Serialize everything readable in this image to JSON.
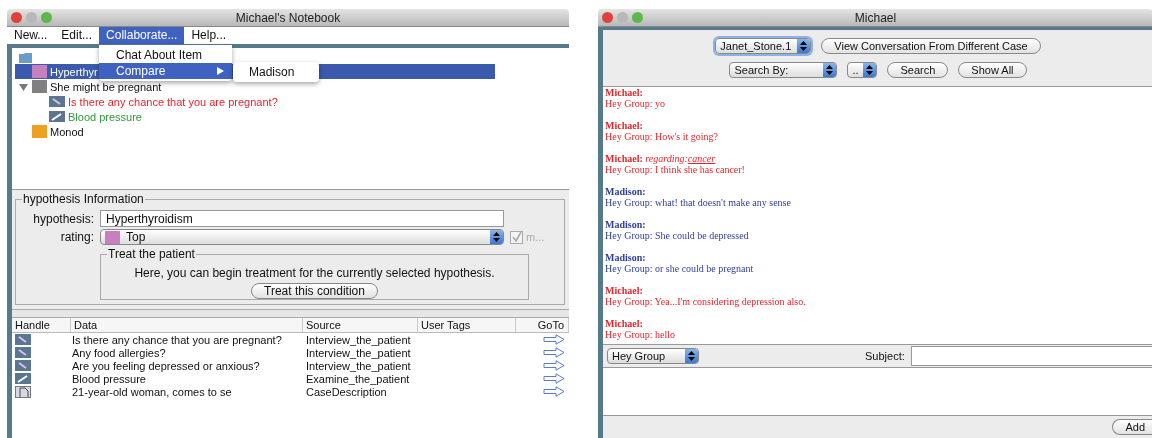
{
  "notebook": {
    "title": "Michael's Notebook",
    "menu": [
      {
        "label": "New...",
        "selected": false
      },
      {
        "label": "Edit...",
        "selected": false
      },
      {
        "label": "Collaborate...",
        "selected": true
      },
      {
        "label": "Help...",
        "selected": false
      }
    ],
    "dropdown": {
      "items": [
        {
          "label": "Chat About Item",
          "selected": false,
          "submenu": false
        },
        {
          "label": "Compare",
          "selected": true,
          "submenu": true
        }
      ],
      "submenu_items": [
        "Madison"
      ]
    },
    "tree": {
      "items": [
        {
          "label": "Hyperthyr",
          "color": "#c67fbf",
          "selected": true
        },
        {
          "label": "She might be pregnant",
          "color": "#808080",
          "selected": false,
          "expanded": true,
          "children": [
            {
              "label": "Is there any chance that you are pregnant?",
              "kind": "interview",
              "color": "#e8242a"
            },
            {
              "label": "Blood pressure",
              "kind": "exam",
              "color": "#2e9a3a"
            }
          ]
        },
        {
          "label": "Monod",
          "color": "#f0a020",
          "selected": false
        }
      ]
    },
    "info": {
      "legend": "hypothesis Information",
      "hypothesis_label": "hypothesis:",
      "hypothesis_value": "Hyperthyroidism",
      "rating_label": "rating:",
      "rating": {
        "value": "Top",
        "color": "#c67fbf"
      },
      "checkbox": {
        "label": "m...",
        "checked": true,
        "disabled": true
      },
      "treat": {
        "legend": "Treat the patient",
        "text": "Here, you can begin treatment for the currently selected hypothesis.",
        "button": "Treat this condition"
      }
    },
    "table": {
      "columns": [
        "Handle",
        "Data",
        "Source",
        "User Tags",
        "GoTo"
      ],
      "rows": [
        {
          "kind": "interview",
          "data": "Is there any chance that you are pregnant?",
          "source": "Interview_the_patient"
        },
        {
          "kind": "interview",
          "data": "Any food allergies?",
          "source": "Interview_the_patient"
        },
        {
          "kind": "interview",
          "data": "Are you feeling depressed or anxious?",
          "source": "Interview_the_patient"
        },
        {
          "kind": "exam",
          "data": "Blood pressure",
          "source": "Examine_the_patient"
        },
        {
          "kind": "case",
          "data": "21-year-old woman, comes to se",
          "source": "CaseDescription"
        }
      ]
    }
  },
  "chat": {
    "title": "Michael",
    "case_select": "Janet_Stone.1",
    "view_button": "View Conversation From Different Case",
    "search_by": "Search By:",
    "search_value": "..",
    "search_button": "Search",
    "show_all_button": "Show All",
    "messages": [
      {
        "sender": "Michael:",
        "color": "#e8242a",
        "text": "Hey Group: yo"
      },
      {
        "sender": "Michael:",
        "color": "#e8242a",
        "text": "Hey Group: How's it going?"
      },
      {
        "sender": "Michael:",
        "color": "#e8242a",
        "regarding_label": "regarding:",
        "regarding_topic": "cancer",
        "text": "Hey Group: I think she has cancer!"
      },
      {
        "sender": "Madison:",
        "color": "#2d3f9a",
        "text": "Hey Group: what! that doesn't make any sense"
      },
      {
        "sender": "Madison:",
        "color": "#2d3f9a",
        "text": "Hey Group: She could be depressed"
      },
      {
        "sender": "Madison:",
        "color": "#2d3f9a",
        "text": "Hey Group: or she could be pregnant"
      },
      {
        "sender": "Michael:",
        "color": "#e8242a",
        "text": "Hey Group: Yea...I'm considering depression also."
      },
      {
        "sender": "Michael:",
        "color": "#e8242a",
        "text": "Hey Group: hello"
      }
    ],
    "recipient": "Hey Group",
    "subject_label": "Subject:",
    "add_button": "Add"
  }
}
